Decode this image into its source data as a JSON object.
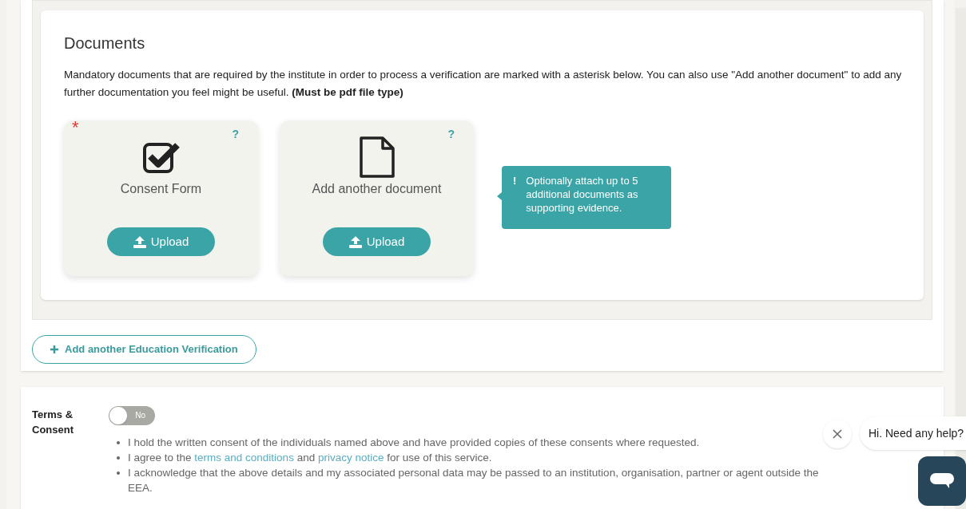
{
  "documents": {
    "title": "Documents",
    "description": "Mandatory documents that are required by the institute in order to process a verification are marked with a asterisk below. You can also use \"Add another document\" to add any further documentation you feel might be useful. **(Must be pdf file type)**",
    "cards": [
      {
        "kind": "checkbox",
        "required_mark": "*",
        "help": "?",
        "label": "Consent Form",
        "button": "Upload"
      },
      {
        "kind": "file",
        "help": "?",
        "label": "Add another document",
        "button": "Upload"
      }
    ],
    "tooltip": {
      "icon": "!",
      "text": "Optionally attach up to 5 additional documents as supporting evidence."
    }
  },
  "add_verification_button": "Add another Education Verification",
  "terms": {
    "label": "Terms & Consent",
    "toggle": {
      "on": false,
      "text": "No"
    },
    "items": [
      [
        {
          "text": "I hold the written consent of the individuals named above and have provided copies of these consents where requested."
        }
      ],
      [
        {
          "text": "I agree to the "
        },
        {
          "text": "terms and conditions",
          "link": true
        },
        {
          "text": " and "
        },
        {
          "text": "privacy notice",
          "link": true
        },
        {
          "text": " for use of this service."
        }
      ],
      [
        {
          "text": "I acknowledge that the above details and my associated personal data may be passed to an institution, organisation, partner or agent outside the EEA."
        }
      ]
    ]
  },
  "chat": {
    "message": "Hi. Need any help?"
  }
}
